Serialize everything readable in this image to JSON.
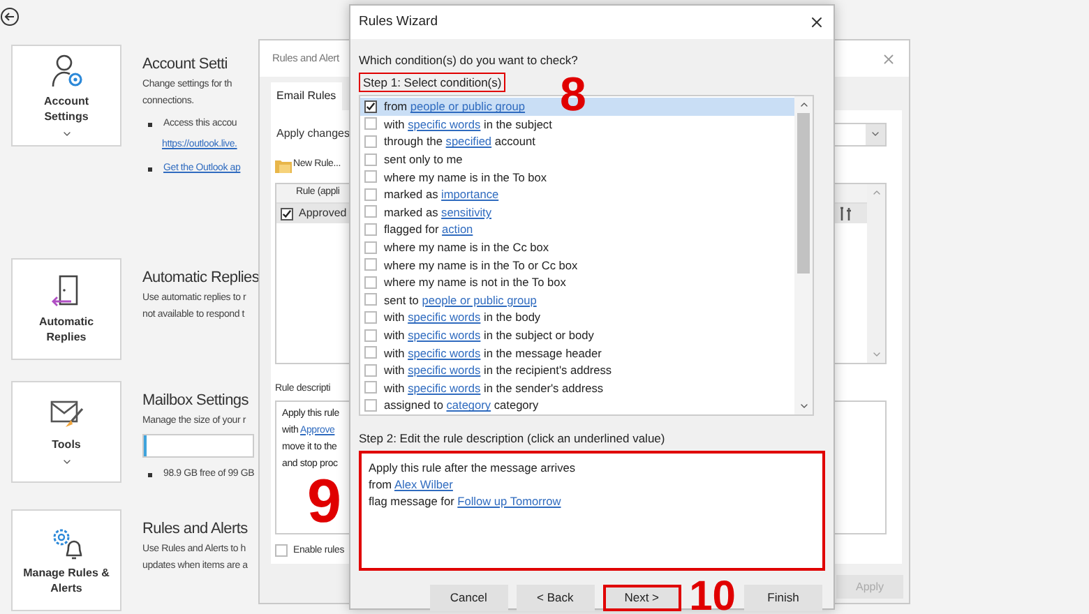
{
  "backstage": {
    "sections": [
      {
        "card_label": "Account Settings",
        "menu": true,
        "title": "Account Setti",
        "lines": [
          {
            "kind": "text",
            "text": "Change settings for th"
          },
          {
            "kind": "text",
            "text": "connections."
          },
          {
            "kind": "bullet",
            "text": "Access this accou"
          },
          {
            "kind": "link",
            "text": "https://outlook.live."
          },
          {
            "kind": "bullet_link",
            "text": "Get the Outlook ap"
          }
        ]
      },
      {
        "card_label": "Automatic Replies",
        "menu": false,
        "title": "Automatic Replies",
        "lines": [
          {
            "kind": "text",
            "text": "Use automatic replies to r"
          },
          {
            "kind": "text",
            "text": "not available to respond t"
          }
        ]
      },
      {
        "card_label": "Tools",
        "menu": true,
        "title": "Mailbox Settings",
        "lines": [
          {
            "kind": "text",
            "text": "Manage the size of your r"
          },
          {
            "kind": "meter",
            "level": 0.03
          },
          {
            "kind": "bullet",
            "text": "98.9 GB free of 99 GB"
          }
        ]
      },
      {
        "card_label": "Manage Rules & Alerts",
        "menu": false,
        "title": "Rules and Alerts",
        "lines": [
          {
            "kind": "text",
            "text": "Use Rules and Alerts to h"
          },
          {
            "kind": "text",
            "text": "updates when items are a"
          }
        ]
      }
    ]
  },
  "rules_and_alerts": {
    "title": "Rules and Alert",
    "tabs": [
      {
        "label": "Email Rules",
        "selected": true
      }
    ],
    "apply_label": "Apply changes",
    "new_rule": "New Rule...",
    "column": "Rule (appli",
    "rules": [
      {
        "name": "Approved",
        "checked": true,
        "selected": true
      }
    ],
    "description_label": "Rule descripti",
    "description": [
      {
        "before": "Apply this rule"
      },
      {
        "before": "with",
        "link": "Approve"
      },
      {
        "before": "move it to the"
      },
      {
        "before": "and stop proc"
      }
    ],
    "enable_rules": {
      "label": "Enable rules",
      "checked": false
    },
    "apply_button": {
      "label": "Apply",
      "disabled": true
    }
  },
  "wizard": {
    "title": "Rules Wizard",
    "question": "Which condition(s) do you want to check?",
    "step1": {
      "label": "Step 1: Select condition(s)",
      "annotated": true
    },
    "conditions": [
      {
        "before": "from",
        "link": "people or public group",
        "checked": true,
        "selected": true
      },
      {
        "before": "with",
        "link": "specific words",
        "after": "in the subject",
        "checked": false,
        "selected": false
      },
      {
        "before": "through the",
        "link": "specified",
        "after": "account",
        "checked": false,
        "selected": false
      },
      {
        "before": "sent only to me",
        "checked": false,
        "selected": false
      },
      {
        "before": "where my name is in the To box",
        "checked": false,
        "selected": false
      },
      {
        "before": "marked as",
        "link": "importance",
        "checked": false,
        "selected": false
      },
      {
        "before": "marked as",
        "link": "sensitivity",
        "checked": false,
        "selected": false
      },
      {
        "before": "flagged for",
        "link": "action",
        "checked": false,
        "selected": false
      },
      {
        "before": "where my name is in the Cc box",
        "checked": false,
        "selected": false
      },
      {
        "before": "where my name is in the To or Cc box",
        "checked": false,
        "selected": false
      },
      {
        "before": "where my name is not in the To box",
        "checked": false,
        "selected": false
      },
      {
        "before": "sent to",
        "link": "people or public group",
        "checked": false,
        "selected": false
      },
      {
        "before": "with",
        "link": "specific words",
        "after": "in the body",
        "checked": false,
        "selected": false
      },
      {
        "before": "with",
        "link": "specific words",
        "after": "in the subject or body",
        "checked": false,
        "selected": false
      },
      {
        "before": "with",
        "link": "specific words",
        "after": "in the message header",
        "checked": false,
        "selected": false
      },
      {
        "before": "with",
        "link": "specific words",
        "after": "in the recipient's address",
        "checked": false,
        "selected": false
      },
      {
        "before": "with",
        "link": "specific words",
        "after": "in the sender's address",
        "checked": false,
        "selected": false
      },
      {
        "before": "assigned to",
        "link": "category",
        "after": "category",
        "checked": false,
        "selected": false
      }
    ],
    "step2": "Step 2: Edit the rule description (click an underlined value)",
    "description": {
      "annotated": true,
      "lines": [
        {
          "before": "Apply this rule after the message arrives"
        },
        {
          "before": "from",
          "link": "Alex Wilber"
        },
        {
          "before": "flag message for",
          "link": "Follow up Tomorrow"
        }
      ]
    },
    "buttons": [
      {
        "label": "Cancel",
        "annotated": false
      },
      {
        "label": "< Back",
        "annotated": false
      },
      {
        "label": "Next >",
        "annotated": true
      },
      {
        "label": "Finish",
        "annotated": false
      }
    ]
  },
  "annotations": [
    {
      "label": "8"
    },
    {
      "label": "9"
    },
    {
      "label": "10"
    }
  ]
}
